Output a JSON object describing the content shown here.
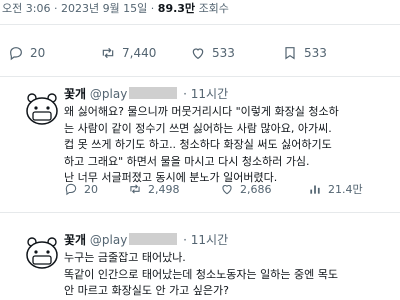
{
  "main_tweet": {
    "meta": {
      "time": "오전 3:06",
      "date": "2023년 9월 15일",
      "sep": "·",
      "views_count": "89.3만",
      "views_label": "조회수"
    },
    "actions": {
      "reply_count": "20",
      "retweet_count": "7,440",
      "like_count": "533"
    }
  },
  "replies": [
    {
      "name": "꽃개",
      "handle": "@play",
      "time": "· 11시간",
      "lines": [
        "왜 싫어해요? 물으니까 머뭇거리시다 \"이렇게 화장실 청소하",
        "는 사람이 같이 정수기 쓰면 싫어하는 사람 많아요, 아가씨.",
        "컵 못 쓰게 하기도 하고.. 청소하다 화장실 써도 싫어하기도",
        "하고 그래요\" 하면서 물을 마시고 다시 청소하러 가심.",
        "난 너무 서글퍼졌고 동시에 분노가 일어버렸다."
      ],
      "actions": {
        "reply_count": "20",
        "retweet_count": "2,498",
        "like_count": "2,686",
        "view_count": "21.4만"
      }
    },
    {
      "name": "꽃개",
      "handle": "@play",
      "time": "· 11시간",
      "lines": [
        "누구는 금줄잡고 태어났나.",
        "똑같이 인간으로 태어났는데 청소노동자는 일하는 중엔 목도",
        "안 마르고 화장실도 안 가고 싶은가?"
      ]
    }
  ],
  "icons": [
    "reply-icon",
    "retweet-icon",
    "like-icon",
    "bookmark-icon",
    "views-icon",
    "avatar-icon"
  ]
}
